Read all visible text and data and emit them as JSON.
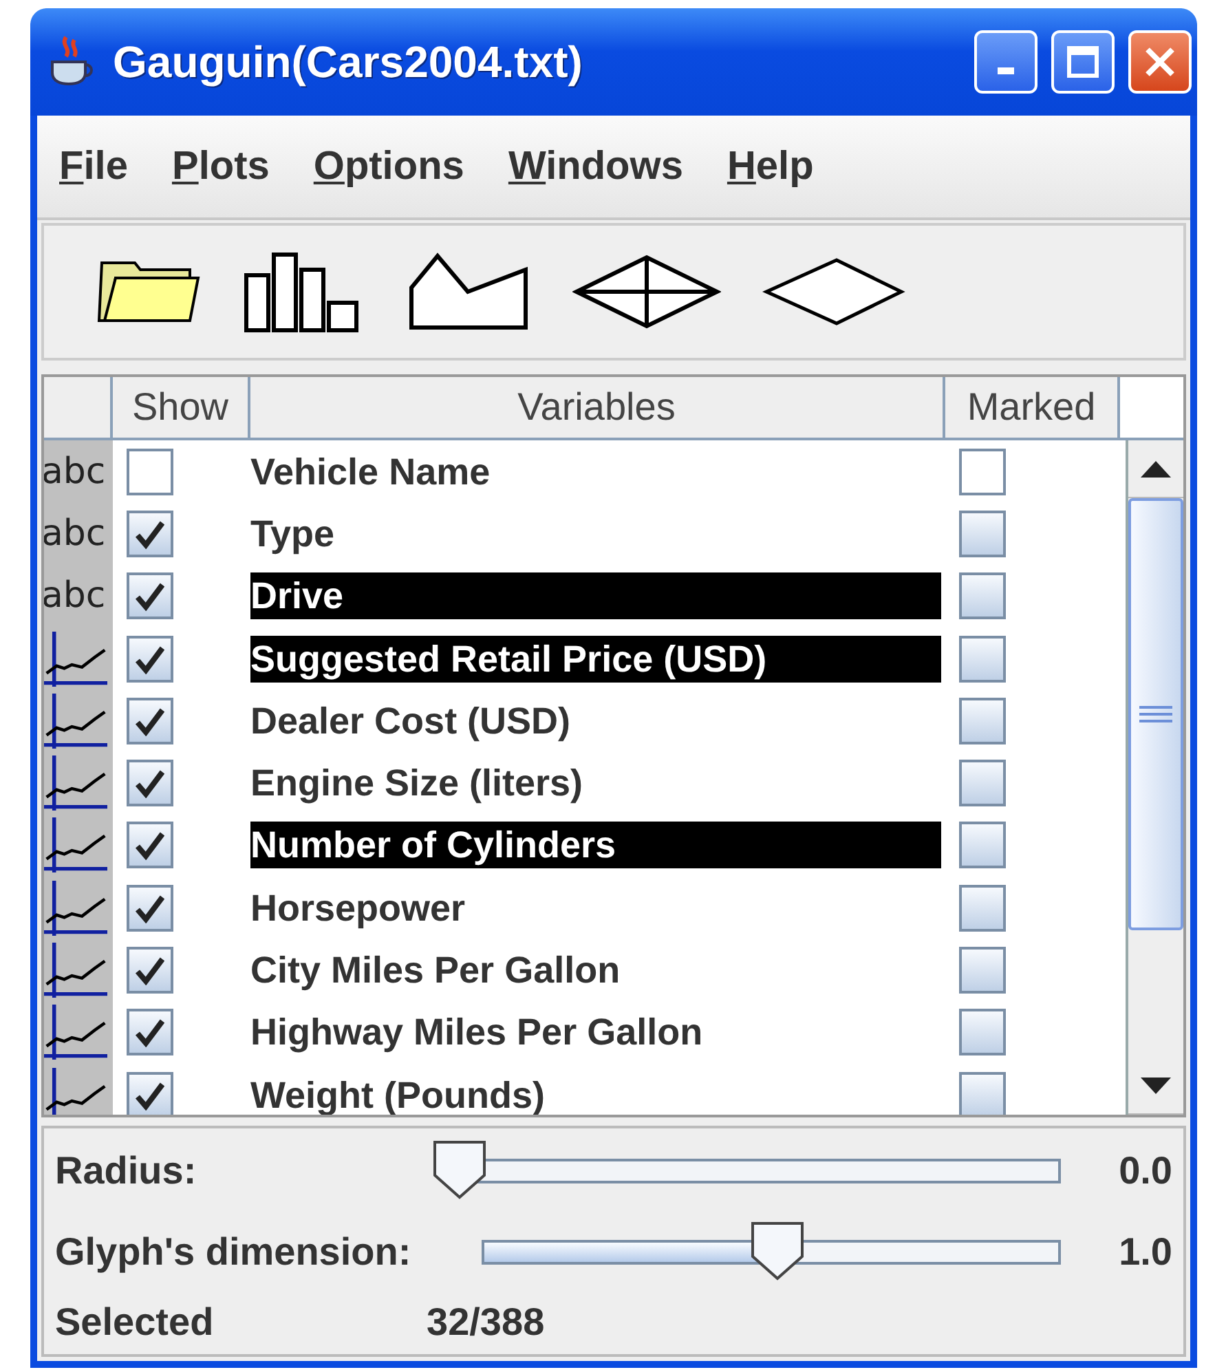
{
  "window": {
    "title": "Gauguin(Cars2004.txt)"
  },
  "menu": [
    "File",
    "Plots",
    "Options",
    "Windows",
    "Help"
  ],
  "toolbar": [
    {
      "kind": "folder"
    },
    {
      "kind": "bars"
    },
    {
      "kind": "area"
    },
    {
      "kind": "star"
    },
    {
      "kind": "diamond"
    }
  ],
  "table": {
    "columns": [
      "Show",
      "Variables",
      "Marked"
    ],
    "rows": [
      {
        "kind": "text",
        "icon_text": "abc",
        "shown": false,
        "name": "Vehicle Name",
        "selected": false,
        "marked": false
      },
      {
        "kind": "text",
        "icon_text": "abc",
        "shown": true,
        "name": "Type",
        "selected": false,
        "marked": false
      },
      {
        "kind": "text",
        "icon_text": "abc",
        "shown": true,
        "name": "Drive",
        "selected": true,
        "marked": false
      },
      {
        "kind": "numeric",
        "shown": true,
        "name": "Suggested Retail Price (USD)",
        "selected": true,
        "marked": false
      },
      {
        "kind": "numeric",
        "shown": true,
        "name": "Dealer Cost (USD)",
        "selected": false,
        "marked": false
      },
      {
        "kind": "numeric",
        "shown": true,
        "name": "Engine Size (liters)",
        "selected": false,
        "marked": false
      },
      {
        "kind": "numeric",
        "shown": true,
        "name": "Number of Cylinders",
        "selected": true,
        "marked": false
      },
      {
        "kind": "numeric",
        "shown": true,
        "name": "Horsepower",
        "selected": false,
        "marked": false
      },
      {
        "kind": "numeric",
        "shown": true,
        "name": "City Miles Per Gallon",
        "selected": false,
        "marked": false
      },
      {
        "kind": "numeric",
        "shown": true,
        "name": "Highway Miles Per Gallon",
        "selected": false,
        "marked": false
      },
      {
        "kind": "numeric",
        "shown": true,
        "name": "Weight (Pounds)",
        "selected": false,
        "marked": false
      }
    ]
  },
  "sliders": [
    {
      "label": "Radius:",
      "level": 0,
      "reading": "0.0"
    },
    {
      "label": "Glyph's dimension:",
      "level": 0.51,
      "reading": "1.0"
    }
  ],
  "status": {
    "label": "Selected",
    "value": "32/388"
  }
}
